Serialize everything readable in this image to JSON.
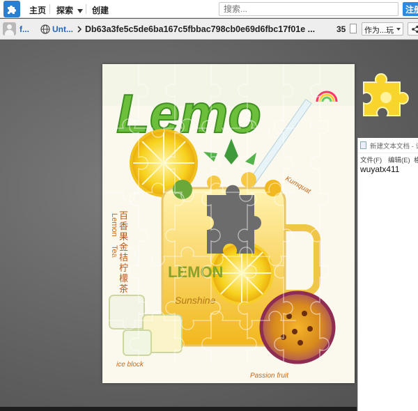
{
  "topbar": {
    "logo_icon": "puzzle-piece-icon",
    "home_label": "主页",
    "explore_label": "探索",
    "create_label": "创建",
    "search_placeholder": "搜索...",
    "signup_label": "注册"
  },
  "project": {
    "author": "f...",
    "studio": "Unt...",
    "title": "Db63a3fe5c5de6ba167c5fbbac798cb0e69d6fbc17f01e ...",
    "piece_count": "35",
    "play_as_label": "作为...玩"
  },
  "poster": {
    "headline": "Lemo",
    "side_english": [
      "Lemon",
      "Tea"
    ],
    "side_chinese": [
      "百",
      "香",
      "果",
      "金",
      "桔",
      "柠",
      "檬",
      "茶"
    ],
    "jar_word": "LEMON",
    "jar_sub": "Sunshine",
    "kumquat": "Kumquat",
    "ice_block": "ice block",
    "passion_fruit": "Passion fruit"
  },
  "notepad": {
    "window_title": "新建文本文档 - 记事本",
    "menu": [
      "文件(F)",
      "编辑(E)",
      "格"
    ],
    "content": "wuyatx411"
  },
  "colors": {
    "accent": "#2d8ae3",
    "link": "#2566b8",
    "lemon_yellow": "#f7d21e",
    "leaf_green": "#6cbf3a"
  }
}
